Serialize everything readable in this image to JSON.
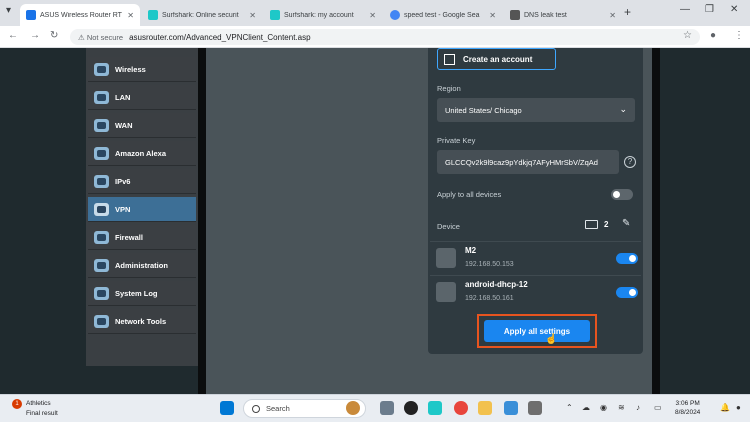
{
  "browser": {
    "tabs": [
      {
        "label": "ASUS Wireless Router RT",
        "active": true,
        "color": "#1a73e8"
      },
      {
        "label": "Surfshark: Online securit",
        "active": false,
        "color": "#1ec8c8"
      },
      {
        "label": "Surfshark: my account",
        "active": false,
        "color": "#1ec8c8"
      },
      {
        "label": "speed test - Google Sea",
        "active": false,
        "color": "#4285f4"
      },
      {
        "label": "DNS leak test",
        "active": false,
        "color": "#555555"
      }
    ],
    "new_tab": "+",
    "address": {
      "security": "Not secure",
      "url": "asusrouter.com/Advanced_VPNClient_Content.asp"
    }
  },
  "sidebar": {
    "items": [
      {
        "label": "Wireless",
        "icon": "wireless-icon",
        "selected": false
      },
      {
        "label": "LAN",
        "icon": "lan-icon",
        "selected": false
      },
      {
        "label": "WAN",
        "icon": "wan-globe-icon",
        "selected": false
      },
      {
        "label": "Amazon Alexa",
        "icon": "alexa-icon",
        "selected": false
      },
      {
        "label": "IPv6",
        "icon": "ipv6-globe-icon",
        "selected": false
      },
      {
        "label": "VPN",
        "icon": "vpn-icon",
        "selected": true
      },
      {
        "label": "Firewall",
        "icon": "firewall-icon",
        "selected": false
      },
      {
        "label": "Administration",
        "icon": "administration-icon",
        "selected": false
      },
      {
        "label": "System Log",
        "icon": "system-log-icon",
        "selected": false
      },
      {
        "label": "Network Tools",
        "icon": "network-tools-icon",
        "selected": false
      }
    ]
  },
  "vpn_panel": {
    "create_account": "Create an account",
    "region_label": "Region",
    "region_value": "United States/ Chicago",
    "private_key_label": "Private Key",
    "private_key_value": "GLCCQv2k9l9caz9pYdkjq7AFyHMrSbV/ZqAd",
    "apply_all_devices_label": "Apply to all devices",
    "apply_all_devices_on": false,
    "device_label": "Device",
    "device_count": "2",
    "devices": [
      {
        "name": "M2",
        "ip": "192.168.50.153",
        "icon": "windows-icon",
        "enabled": true
      },
      {
        "name": "android-dhcp-12",
        "ip": "192.168.50.161",
        "icon": "phone-icon",
        "enabled": true
      }
    ],
    "apply_button": "Apply all settings"
  },
  "taskbar": {
    "news_title": "Athletics",
    "news_sub": "Final result",
    "news_badge": "1",
    "search_placeholder": "Search",
    "time": "3:06 PM",
    "date": "8/8/2024"
  }
}
